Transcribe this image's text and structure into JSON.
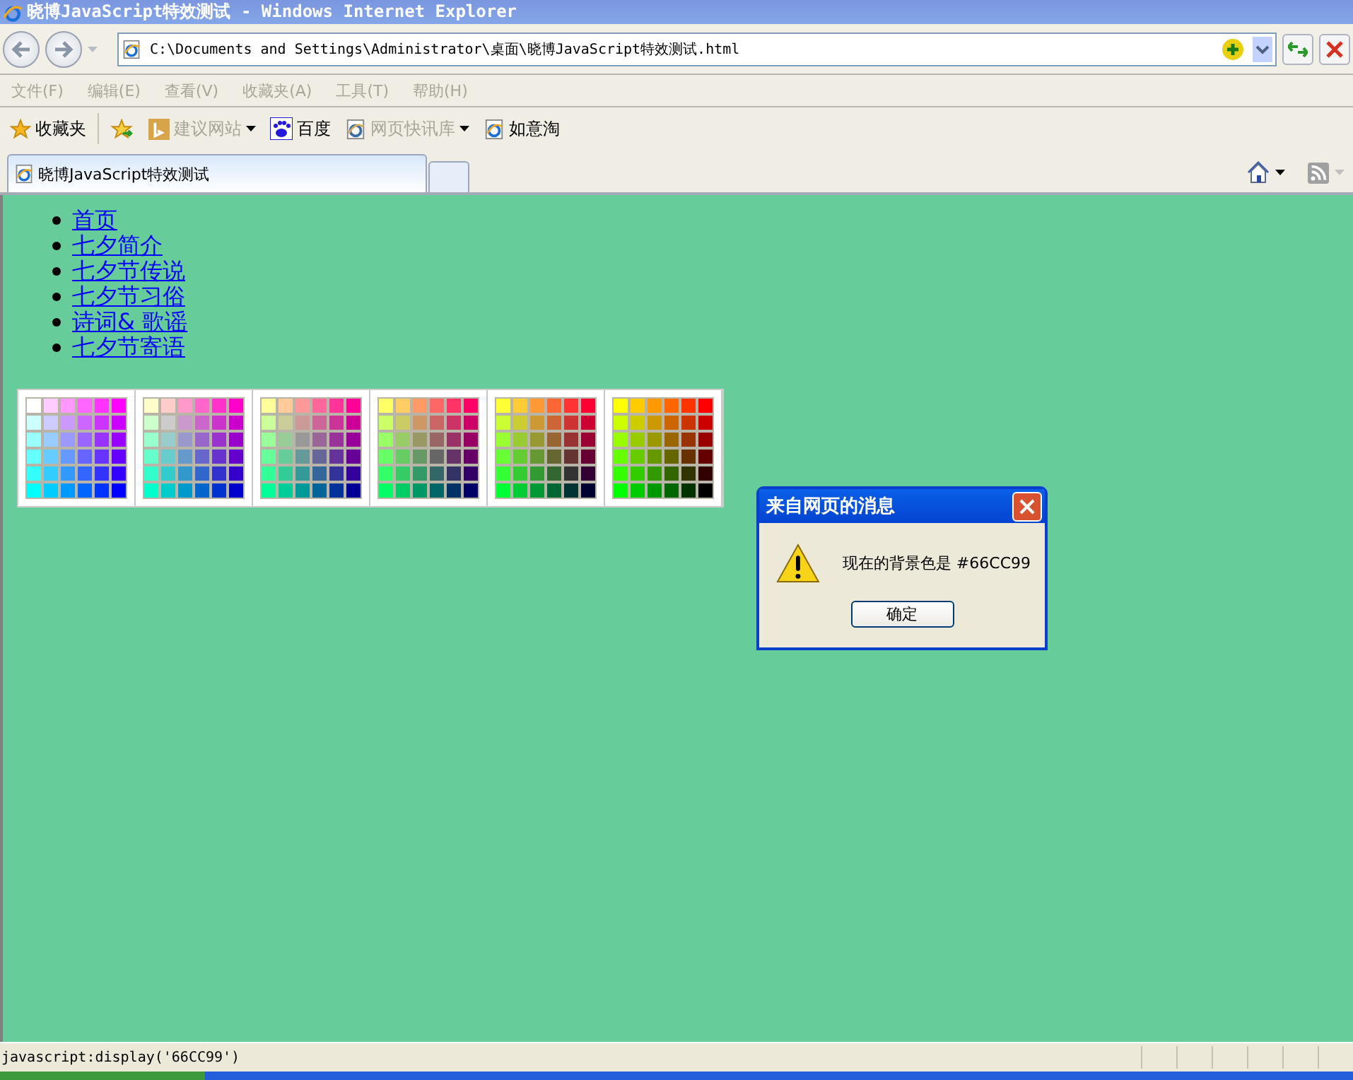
{
  "window": {
    "title": "晓博JavaScript特效测试 - Windows Internet Explorer"
  },
  "address_bar": {
    "value": "C:\\Documents and Settings\\Administrator\\桌面\\晓博JavaScript特效测试.html"
  },
  "menu": [
    {
      "label": "文件(F)",
      "disabled": true
    },
    {
      "label": "编辑(E)",
      "disabled": true
    },
    {
      "label": "查看(V)",
      "disabled": true
    },
    {
      "label": "收藏夹(A)",
      "disabled": true
    },
    {
      "label": "工具(T)",
      "disabled": true
    },
    {
      "label": "帮助(H)",
      "disabled": true
    }
  ],
  "favorites_bar": [
    {
      "kind": "star",
      "label": "收藏夹",
      "dropdown": false,
      "disabled": false
    },
    {
      "kind": "add",
      "dropdown": false,
      "disabled": false
    },
    {
      "kind": "bing",
      "label": "建议网站",
      "dropdown": true,
      "disabled": true
    },
    {
      "kind": "paw",
      "label": "百度",
      "dropdown": false,
      "disabled": false
    },
    {
      "kind": "page",
      "label": "网页快讯库",
      "dropdown": true,
      "disabled": true
    },
    {
      "kind": "page",
      "label": "如意淘",
      "dropdown": false,
      "disabled": false
    }
  ],
  "tabs": [
    {
      "label": "晓博JavaScript特效测试",
      "selected": true
    }
  ],
  "links": [
    "首页",
    "七夕简介",
    "七夕节传说",
    "七夕节习俗",
    "诗词& 歌谣",
    "七夕节寄语"
  ],
  "palette": [
    {
      "swatches": [
        {
          "color": "#ffffff"
        },
        {
          "color": "#ffccff"
        },
        {
          "color": "#ff99ff"
        },
        {
          "color": "#ff66ff"
        },
        {
          "color": "#ff33ff"
        },
        {
          "color": "#ff00ff"
        },
        {
          "color": "#ccffff"
        },
        {
          "color": "#ccccff"
        },
        {
          "color": "#cc99ff"
        },
        {
          "color": "#cc66ff"
        },
        {
          "color": "#cc33ff"
        },
        {
          "color": "#cc00ff"
        },
        {
          "color": "#99ffff"
        },
        {
          "color": "#99ccff"
        },
        {
          "color": "#9999ff"
        },
        {
          "color": "#9966ff"
        },
        {
          "color": "#9933ff"
        },
        {
          "color": "#9900ff"
        },
        {
          "color": "#66ffff"
        },
        {
          "color": "#66ccff"
        },
        {
          "color": "#6699ff"
        },
        {
          "color": "#6666ff"
        },
        {
          "color": "#6633ff"
        },
        {
          "color": "#6600ff"
        },
        {
          "color": "#33ffff"
        },
        {
          "color": "#33ccff"
        },
        {
          "color": "#3399ff"
        },
        {
          "color": "#3366ff"
        },
        {
          "color": "#3333ff"
        },
        {
          "color": "#3300ff"
        },
        {
          "color": "#00ffff"
        },
        {
          "color": "#00ccff"
        },
        {
          "color": "#0099ff"
        },
        {
          "color": "#0066ff"
        },
        {
          "color": "#0033ff"
        },
        {
          "color": "#0000ff"
        }
      ]
    },
    {
      "swatches": [
        {
          "color": "#ffffcc"
        },
        {
          "color": "#ffcccc"
        },
        {
          "color": "#ff99cc"
        },
        {
          "color": "#ff66cc"
        },
        {
          "color": "#ff33cc"
        },
        {
          "color": "#ff00cc"
        },
        {
          "color": "#ccffcc"
        },
        {
          "color": "#cccccc"
        },
        {
          "color": "#cc99cc"
        },
        {
          "color": "#cc66cc"
        },
        {
          "color": "#cc33cc"
        },
        {
          "color": "#cc00cc"
        },
        {
          "color": "#99ffcc"
        },
        {
          "color": "#99cccc"
        },
        {
          "color": "#9999cc"
        },
        {
          "color": "#9966cc"
        },
        {
          "color": "#9933cc"
        },
        {
          "color": "#9900cc"
        },
        {
          "color": "#66ffcc"
        },
        {
          "color": "#66cccc"
        },
        {
          "color": "#6699cc"
        },
        {
          "color": "#6666cc"
        },
        {
          "color": "#6633cc"
        },
        {
          "color": "#6600cc"
        },
        {
          "color": "#33ffcc"
        },
        {
          "color": "#33cccc"
        },
        {
          "color": "#3399cc"
        },
        {
          "color": "#3366cc"
        },
        {
          "color": "#3333cc"
        },
        {
          "color": "#3300cc"
        },
        {
          "color": "#00ffcc"
        },
        {
          "color": "#00cccc"
        },
        {
          "color": "#0099cc"
        },
        {
          "color": "#0066cc"
        },
        {
          "color": "#0033cc"
        },
        {
          "color": "#0000cc"
        }
      ]
    },
    {
      "swatches": [
        {
          "color": "#ffff99"
        },
        {
          "color": "#ffcc99"
        },
        {
          "color": "#ff9999"
        },
        {
          "color": "#ff6699"
        },
        {
          "color": "#ff3399"
        },
        {
          "color": "#ff0099"
        },
        {
          "color": "#ccff99"
        },
        {
          "color": "#cccc99"
        },
        {
          "color": "#cc9999"
        },
        {
          "color": "#cc6699"
        },
        {
          "color": "#cc3399"
        },
        {
          "color": "#cc0099"
        },
        {
          "color": "#99ff99"
        },
        {
          "color": "#99cc99"
        },
        {
          "color": "#999999"
        },
        {
          "color": "#996699"
        },
        {
          "color": "#993399"
        },
        {
          "color": "#990099"
        },
        {
          "color": "#66ff99"
        },
        {
          "color": "#66cc99"
        },
        {
          "color": "#669999"
        },
        {
          "color": "#666699"
        },
        {
          "color": "#663399"
        },
        {
          "color": "#660099"
        },
        {
          "color": "#33ff99"
        },
        {
          "color": "#33cc99"
        },
        {
          "color": "#339999"
        },
        {
          "color": "#336699"
        },
        {
          "color": "#333399"
        },
        {
          "color": "#330099"
        },
        {
          "color": "#00ff99"
        },
        {
          "color": "#00cc99"
        },
        {
          "color": "#009999"
        },
        {
          "color": "#006699"
        },
        {
          "color": "#003399"
        },
        {
          "color": "#000099"
        }
      ]
    },
    {
      "swatches": [
        {
          "color": "#ffff66"
        },
        {
          "color": "#ffcc66"
        },
        {
          "color": "#ff9966"
        },
        {
          "color": "#ff6666"
        },
        {
          "color": "#ff3366"
        },
        {
          "color": "#ff0066"
        },
        {
          "color": "#ccff66"
        },
        {
          "color": "#cccc66"
        },
        {
          "color": "#cc9966"
        },
        {
          "color": "#cc6666"
        },
        {
          "color": "#cc3366"
        },
        {
          "color": "#cc0066"
        },
        {
          "color": "#99ff66"
        },
        {
          "color": "#99cc66"
        },
        {
          "color": "#999966"
        },
        {
          "color": "#996666"
        },
        {
          "color": "#993366"
        },
        {
          "color": "#990066"
        },
        {
          "color": "#66ff66"
        },
        {
          "color": "#66cc66"
        },
        {
          "color": "#669966"
        },
        {
          "color": "#666666"
        },
        {
          "color": "#663366"
        },
        {
          "color": "#660066"
        },
        {
          "color": "#33ff66"
        },
        {
          "color": "#33cc66"
        },
        {
          "color": "#339966"
        },
        {
          "color": "#336666"
        },
        {
          "color": "#333366"
        },
        {
          "color": "#330066"
        },
        {
          "color": "#00ff66"
        },
        {
          "color": "#00cc66"
        },
        {
          "color": "#009966"
        },
        {
          "color": "#006666"
        },
        {
          "color": "#003366"
        },
        {
          "color": "#000066"
        }
      ]
    },
    {
      "swatches": [
        {
          "color": "#ffff33"
        },
        {
          "color": "#ffcc33"
        },
        {
          "color": "#ff9933"
        },
        {
          "color": "#ff6633"
        },
        {
          "color": "#ff3333"
        },
        {
          "color": "#ff0033"
        },
        {
          "color": "#ccff33"
        },
        {
          "color": "#cccc33"
        },
        {
          "color": "#cc9933"
        },
        {
          "color": "#cc6633"
        },
        {
          "color": "#cc3333"
        },
        {
          "color": "#cc0033"
        },
        {
          "color": "#99ff33"
        },
        {
          "color": "#99cc33"
        },
        {
          "color": "#999933"
        },
        {
          "color": "#996633"
        },
        {
          "color": "#993333"
        },
        {
          "color": "#990033"
        },
        {
          "color": "#66ff33"
        },
        {
          "color": "#66cc33"
        },
        {
          "color": "#669933"
        },
        {
          "color": "#666633"
        },
        {
          "color": "#663333"
        },
        {
          "color": "#660033"
        },
        {
          "color": "#33ff33"
        },
        {
          "color": "#33cc33"
        },
        {
          "color": "#339933"
        },
        {
          "color": "#336633"
        },
        {
          "color": "#333333"
        },
        {
          "color": "#330033"
        },
        {
          "color": "#00ff33"
        },
        {
          "color": "#00cc33"
        },
        {
          "color": "#009933"
        },
        {
          "color": "#006633"
        },
        {
          "color": "#003333"
        },
        {
          "color": "#000033"
        }
      ]
    },
    {
      "swatches": [
        {
          "color": "#ffff00"
        },
        {
          "color": "#ffcc00"
        },
        {
          "color": "#ff9900"
        },
        {
          "color": "#ff6600"
        },
        {
          "color": "#ff3300"
        },
        {
          "color": "#ff0000"
        },
        {
          "color": "#ccff00"
        },
        {
          "color": "#cccc00"
        },
        {
          "color": "#cc9900"
        },
        {
          "color": "#cc6600"
        },
        {
          "color": "#cc3300"
        },
        {
          "color": "#cc0000"
        },
        {
          "color": "#99ff00"
        },
        {
          "color": "#99cc00"
        },
        {
          "color": "#999900"
        },
        {
          "color": "#996600"
        },
        {
          "color": "#993300"
        },
        {
          "color": "#990000"
        },
        {
          "color": "#66ff00"
        },
        {
          "color": "#66cc00"
        },
        {
          "color": "#669900"
        },
        {
          "color": "#666600"
        },
        {
          "color": "#663300"
        },
        {
          "color": "#660000"
        },
        {
          "color": "#33ff00"
        },
        {
          "color": "#33cc00"
        },
        {
          "color": "#339900"
        },
        {
          "color": "#336600"
        },
        {
          "color": "#333300"
        },
        {
          "color": "#330000"
        },
        {
          "color": "#00ff00"
        },
        {
          "color": "#00cc00"
        },
        {
          "color": "#009900"
        },
        {
          "color": "#006600"
        },
        {
          "color": "#003300"
        },
        {
          "color": "#000000"
        }
      ]
    }
  ],
  "dialog": {
    "title": "来自网页的消息",
    "message": "现在的背景色是 #66CC99",
    "button": "确定"
  },
  "status_bar": {
    "text": "javascript:display('66CC99')"
  }
}
